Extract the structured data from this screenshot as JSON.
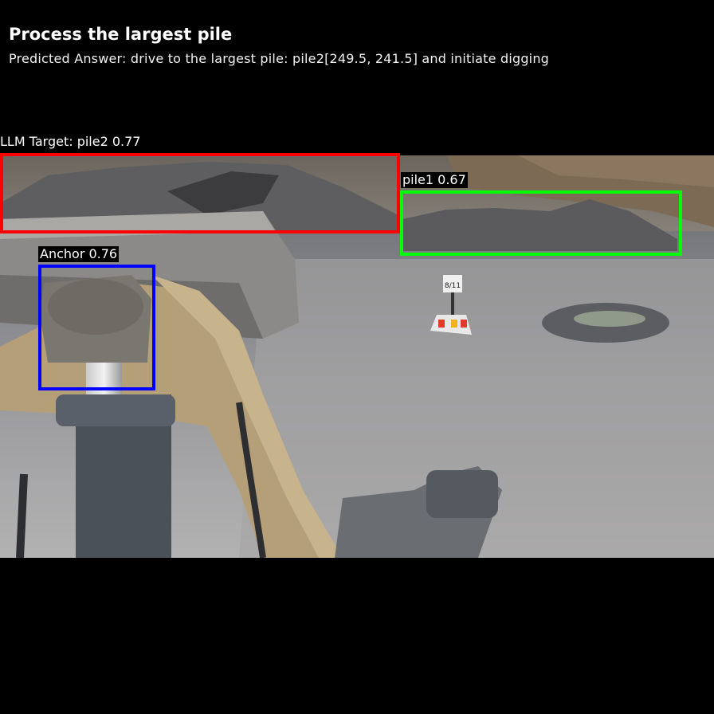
{
  "header": {
    "title": "Process the largest pile",
    "answer": "Predicted Answer: drive to the largest pile: pile2[249.5, 241.5] and initiate digging"
  },
  "detections": {
    "target": {
      "label": "LLM Target: pile2 0.77",
      "color": "#ff0000"
    },
    "pile1": {
      "label": "pile1 0.67",
      "color": "#00ff00"
    },
    "anchor": {
      "label": "Anchor 0.76",
      "color": "#0000ff"
    }
  },
  "scene": {
    "sign_text": "8/11"
  }
}
